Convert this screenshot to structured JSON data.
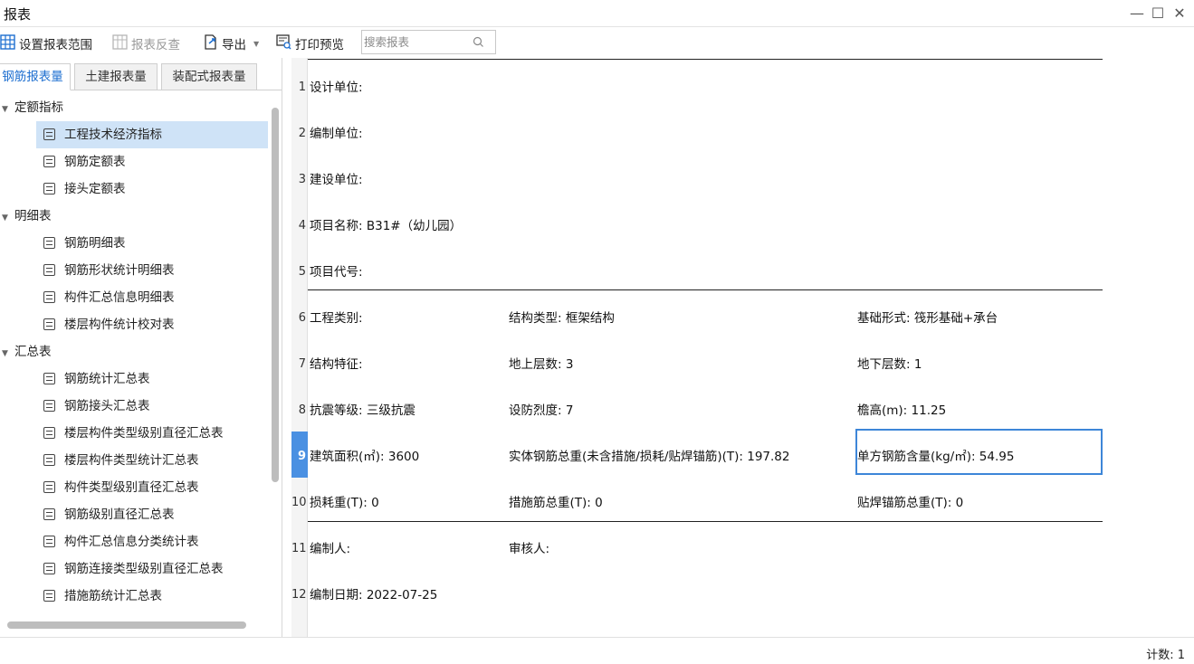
{
  "window": {
    "title": "报表"
  },
  "toolbar": {
    "set_range": "设置报表范围",
    "reverse_check": "报表反查",
    "export": "导出",
    "print_preview": "打印预览",
    "search_placeholder": "搜索报表"
  },
  "tabs": [
    "钢筋报表量",
    "土建报表量",
    "装配式报表量"
  ],
  "tree": {
    "groups": [
      {
        "label": "定额指标",
        "items": [
          "工程技术经济指标",
          "钢筋定额表",
          "接头定额表"
        ]
      },
      {
        "label": "明细表",
        "items": [
          "钢筋明细表",
          "钢筋形状统计明细表",
          "构件汇总信息明细表",
          "楼层构件统计校对表"
        ]
      },
      {
        "label": "汇总表",
        "items": [
          "钢筋统计汇总表",
          "钢筋接头汇总表",
          "楼层构件类型级别直径汇总表",
          "楼层构件类型统计汇总表",
          "构件类型级别直径汇总表",
          "钢筋级别直径汇总表",
          "构件汇总信息分类统计表",
          "钢筋连接类型级别直径汇总表",
          "措施筋统计汇总表"
        ]
      }
    ],
    "selected": "工程技术经济指标"
  },
  "report": {
    "rows": [
      {
        "num": "1",
        "cells": [
          "设计单位:",
          "",
          ""
        ]
      },
      {
        "num": "2",
        "cells": [
          "编制单位:",
          "",
          ""
        ]
      },
      {
        "num": "3",
        "cells": [
          "建设单位:",
          "",
          ""
        ]
      },
      {
        "num": "4",
        "cells": [
          "项目名称: B31#（幼儿园）",
          "",
          ""
        ]
      },
      {
        "num": "5",
        "cells": [
          "项目代号:",
          "",
          ""
        ]
      },
      {
        "num": "6",
        "cells": [
          "工程类别:",
          "结构类型: 框架结构",
          "基础形式: 筏形基础+承台"
        ]
      },
      {
        "num": "7",
        "cells": [
          "结构特征:",
          "地上层数: 3",
          "地下层数: 1"
        ]
      },
      {
        "num": "8",
        "cells": [
          "抗震等级: 三级抗震",
          "设防烈度: 7",
          "檐高(m): 11.25"
        ]
      },
      {
        "num": "9",
        "cells": [
          "建筑面积(㎡): 3600",
          "实体钢筋总重(未含措施/损耗/贴焊锚筋)(T): 197.82",
          "单方钢筋含量(kg/㎡): 54.95"
        ]
      },
      {
        "num": "10",
        "cells": [
          "损耗重(T): 0",
          "措施筋总重(T): 0",
          "贴焊锚筋总重(T): 0"
        ]
      },
      {
        "num": "11",
        "cells": [
          "编制人:",
          "审核人:",
          ""
        ]
      },
      {
        "num": "12",
        "cells": [
          "编制日期: 2022-07-25",
          "",
          ""
        ]
      }
    ],
    "active_row": 9
  },
  "status": {
    "count": "计数: 1"
  }
}
